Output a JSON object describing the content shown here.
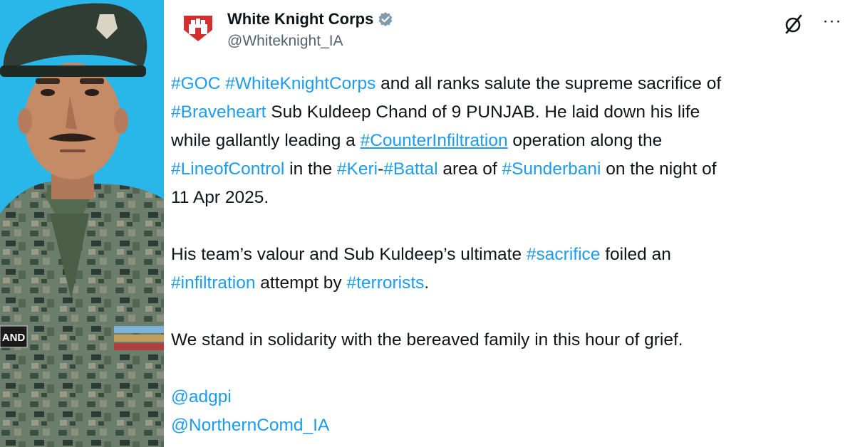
{
  "colors": {
    "photo_bg": "#29b6e8",
    "link": "#1d9bf0",
    "text": "#0f1419",
    "muted": "#536471",
    "verified": "#829aab"
  },
  "icons": {
    "verified": "verified-badge-icon",
    "grok": "grok-icon",
    "more": "more-options-icon",
    "avatar": "white-knight-corps-emblem"
  },
  "photo": {
    "name_tag": "AND"
  },
  "post": {
    "display_name": "White Knight Corps",
    "handle": "@Whiteknight_IA",
    "more_label": "···",
    "p1": {
      "l1": {
        "a": "#GOC",
        "b": "#WhiteKnightCorps",
        "t1": " and all ranks salute the supreme sacrifice of"
      },
      "l2": {
        "a": "#Braveheart",
        "t1": " Sub Kuldeep Chand of 9 PUNJAB. He laid down his life"
      },
      "l3": {
        "t1": "while gallantly leading a ",
        "a": "#CounterInfiltration",
        "t2": " operation along the"
      },
      "l4": {
        "a": "#LineofControl",
        "t1": " in the ",
        "b": "#Keri",
        "t2": "-",
        "c": "#Battal",
        "t3": " area of ",
        "d": "#Sunderbani",
        "t4": " on the night of"
      },
      "l5": {
        "t1": "11 Apr 2025."
      }
    },
    "p2": {
      "l1": {
        "t1": "His team’s valour and Sub Kuldeep’s ultimate ",
        "a": "#sacrifice",
        "t2": " foiled an"
      },
      "l2": {
        "a": "#infiltration",
        "t1": " attempt by ",
        "b": "#terrorists",
        "t2": "."
      }
    },
    "p3": {
      "l1": "We stand in solidarity with the bereaved family in this hour of grief."
    },
    "mentions": [
      "@adgpi",
      "@NorthernComd_IA"
    ]
  }
}
